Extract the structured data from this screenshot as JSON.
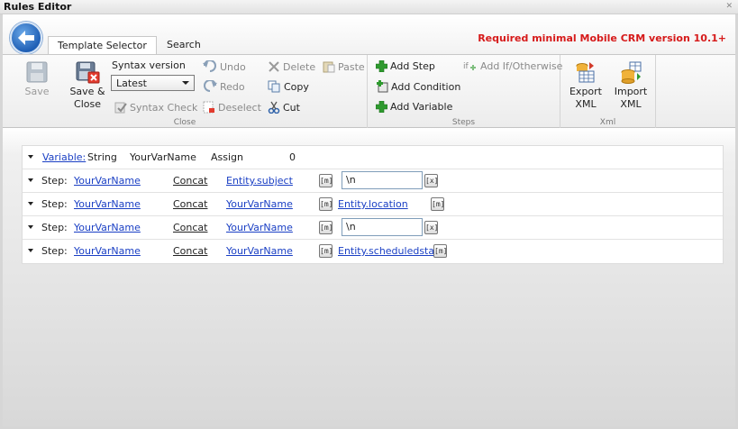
{
  "window": {
    "title": "Rules Editor"
  },
  "tabs": [
    {
      "label": "Template Selector",
      "active": true
    },
    {
      "label": "Search",
      "active": false
    }
  ],
  "crm_note": "Required minimal Mobile CRM version 10.1+",
  "ribbon": {
    "close_group": {
      "label": "Close",
      "save": "Save",
      "save_close_line1": "Save &",
      "save_close_line2": "Close",
      "syntax_version_label": "Syntax version",
      "syntax_version_value": "Latest",
      "syntax_check": "Syntax Check",
      "undo": "Undo",
      "redo": "Redo",
      "deselect": "Deselect",
      "delete": "Delete",
      "copy": "Copy",
      "cut": "Cut",
      "paste": "Paste"
    },
    "steps_group": {
      "label": "Steps",
      "add_step": "Add Step",
      "add_condition": "Add Condition",
      "add_variable": "Add Variable",
      "add_if_otherwise": "Add If/Otherwise"
    },
    "xml_group": {
      "label": "Xml",
      "export_line1": "Export",
      "export_line2": "XML",
      "import_line1": "Import",
      "import_line2": "XML"
    }
  },
  "rows": [
    {
      "kind": "Variable:",
      "type": "String",
      "name": "YourVarName",
      "op": "Assign",
      "value": "0"
    },
    {
      "kind": "Step:",
      "target": "YourVarName",
      "op": "Concat",
      "source": "Entity.subject",
      "token": "[m]",
      "text": "\\n",
      "token2": "[x]"
    },
    {
      "kind": "Step:",
      "target": "YourVarName",
      "op": "Concat",
      "source": "YourVarName",
      "token": "[m]",
      "expr": "Entity.location",
      "token2": "[m]"
    },
    {
      "kind": "Step:",
      "target": "YourVarName",
      "op": "Concat",
      "source": "YourVarName",
      "token": "[m]",
      "text": "\\n",
      "token2": "[x]"
    },
    {
      "kind": "Step:",
      "target": "YourVarName",
      "op": "Concat",
      "source": "YourVarName",
      "token": "[m]",
      "expr": "Entity.scheduledstart",
      "token2": "[m]"
    }
  ]
}
